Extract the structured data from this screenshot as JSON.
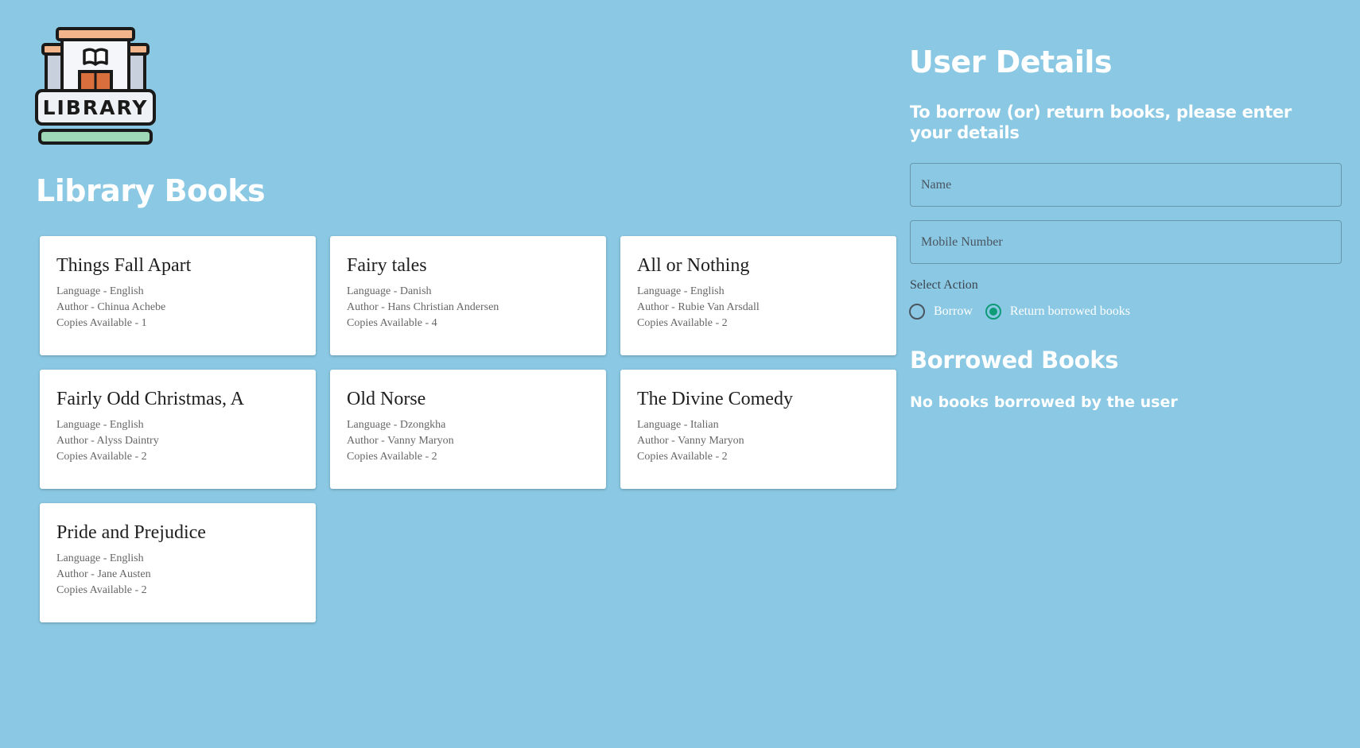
{
  "logo": {
    "text": "LIBRARY",
    "icon": "library-building-icon"
  },
  "library": {
    "title": "Library Books",
    "books": [
      {
        "title": "Things Fall Apart",
        "language": "Language - English",
        "author": "Author - Chinua Achebe",
        "copies": "Copies Available - 1"
      },
      {
        "title": "Fairy tales",
        "language": "Language - Danish",
        "author": "Author - Hans Christian Andersen",
        "copies": "Copies Available - 4"
      },
      {
        "title": "All or Nothing",
        "language": "Language - English",
        "author": "Author - Rubie Van Arsdall",
        "copies": "Copies Available - 2"
      },
      {
        "title": "Fairly Odd Christmas, A",
        "language": "Language - English",
        "author": "Author - Alyss Daintry",
        "copies": "Copies Available - 2"
      },
      {
        "title": "Old Norse",
        "language": "Language - Dzongkha",
        "author": "Author - Vanny Maryon",
        "copies": "Copies Available - 2"
      },
      {
        "title": "The Divine Comedy",
        "language": "Language - Italian",
        "author": "Author - Vanny Maryon",
        "copies": "Copies Available - 2"
      },
      {
        "title": "Pride and Prejudice",
        "language": "Language - English",
        "author": "Author - Jane Austen",
        "copies": "Copies Available - 2"
      }
    ]
  },
  "user": {
    "title": "User Details",
    "subtitle": "To borrow (or) return books, please enter your details",
    "name_placeholder": "Name",
    "name_value": "",
    "mobile_placeholder": "Mobile Number",
    "mobile_value": "",
    "select_action_label": "Select Action",
    "actions": [
      {
        "label": "Borrow",
        "checked": false
      },
      {
        "label": "Return borrowed books",
        "checked": true
      }
    ]
  },
  "borrowed": {
    "title": "Borrowed Books",
    "empty_message": "No books borrowed by the user"
  },
  "colors": {
    "background": "#8ac8e3",
    "accent": "#0d9b78",
    "card": "#ffffff"
  }
}
